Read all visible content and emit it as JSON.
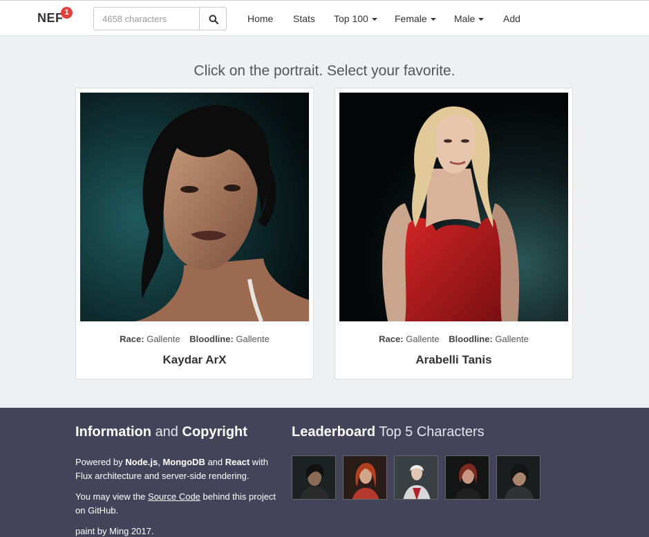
{
  "navbar": {
    "brand": "NEF",
    "badge_count": "1",
    "search_placeholder": "4658 characters",
    "items": [
      {
        "label": "Home"
      },
      {
        "label": "Stats"
      },
      {
        "label": "Top 100"
      },
      {
        "label": "Female"
      },
      {
        "label": "Male"
      },
      {
        "label": "Add"
      }
    ]
  },
  "main": {
    "headline": "Click on the portrait. Select your favorite.",
    "characters": [
      {
        "race_label": "Race:",
        "race": "Gallente",
        "bloodline_label": "Bloodline:",
        "bloodline": "Gallente",
        "name": "Kaydar ArX"
      },
      {
        "race_label": "Race:",
        "race": "Gallente",
        "bloodline_label": "Bloodline:",
        "bloodline": "Gallente",
        "name": "Arabelli Tanis"
      }
    ]
  },
  "footer": {
    "info": {
      "title_a": "Information",
      "title_and": "and",
      "title_b": "Copyright",
      "powered_prefix": "Powered by ",
      "tech1": "Node.js",
      "sep1": ", ",
      "tech2": "MongoDB",
      "sep2": " and ",
      "tech3": "React",
      "powered_suffix": " with Flux architecture and server-side rendering.",
      "source_prefix": "You may view the ",
      "source_link": "Source Code",
      "source_suffix": " behind this project on GitHub.",
      "credit": "paint by Ming 2017."
    },
    "leaderboard": {
      "title_bold": "Leaderboard",
      "title_light": "Top 5 Characters",
      "thumbs": [
        "character-1",
        "character-2",
        "character-3",
        "character-4",
        "character-5"
      ]
    }
  },
  "colors": {
    "badge": "#e0413b",
    "footer_bg": "#434459",
    "page_bg": "#eef0f1"
  }
}
